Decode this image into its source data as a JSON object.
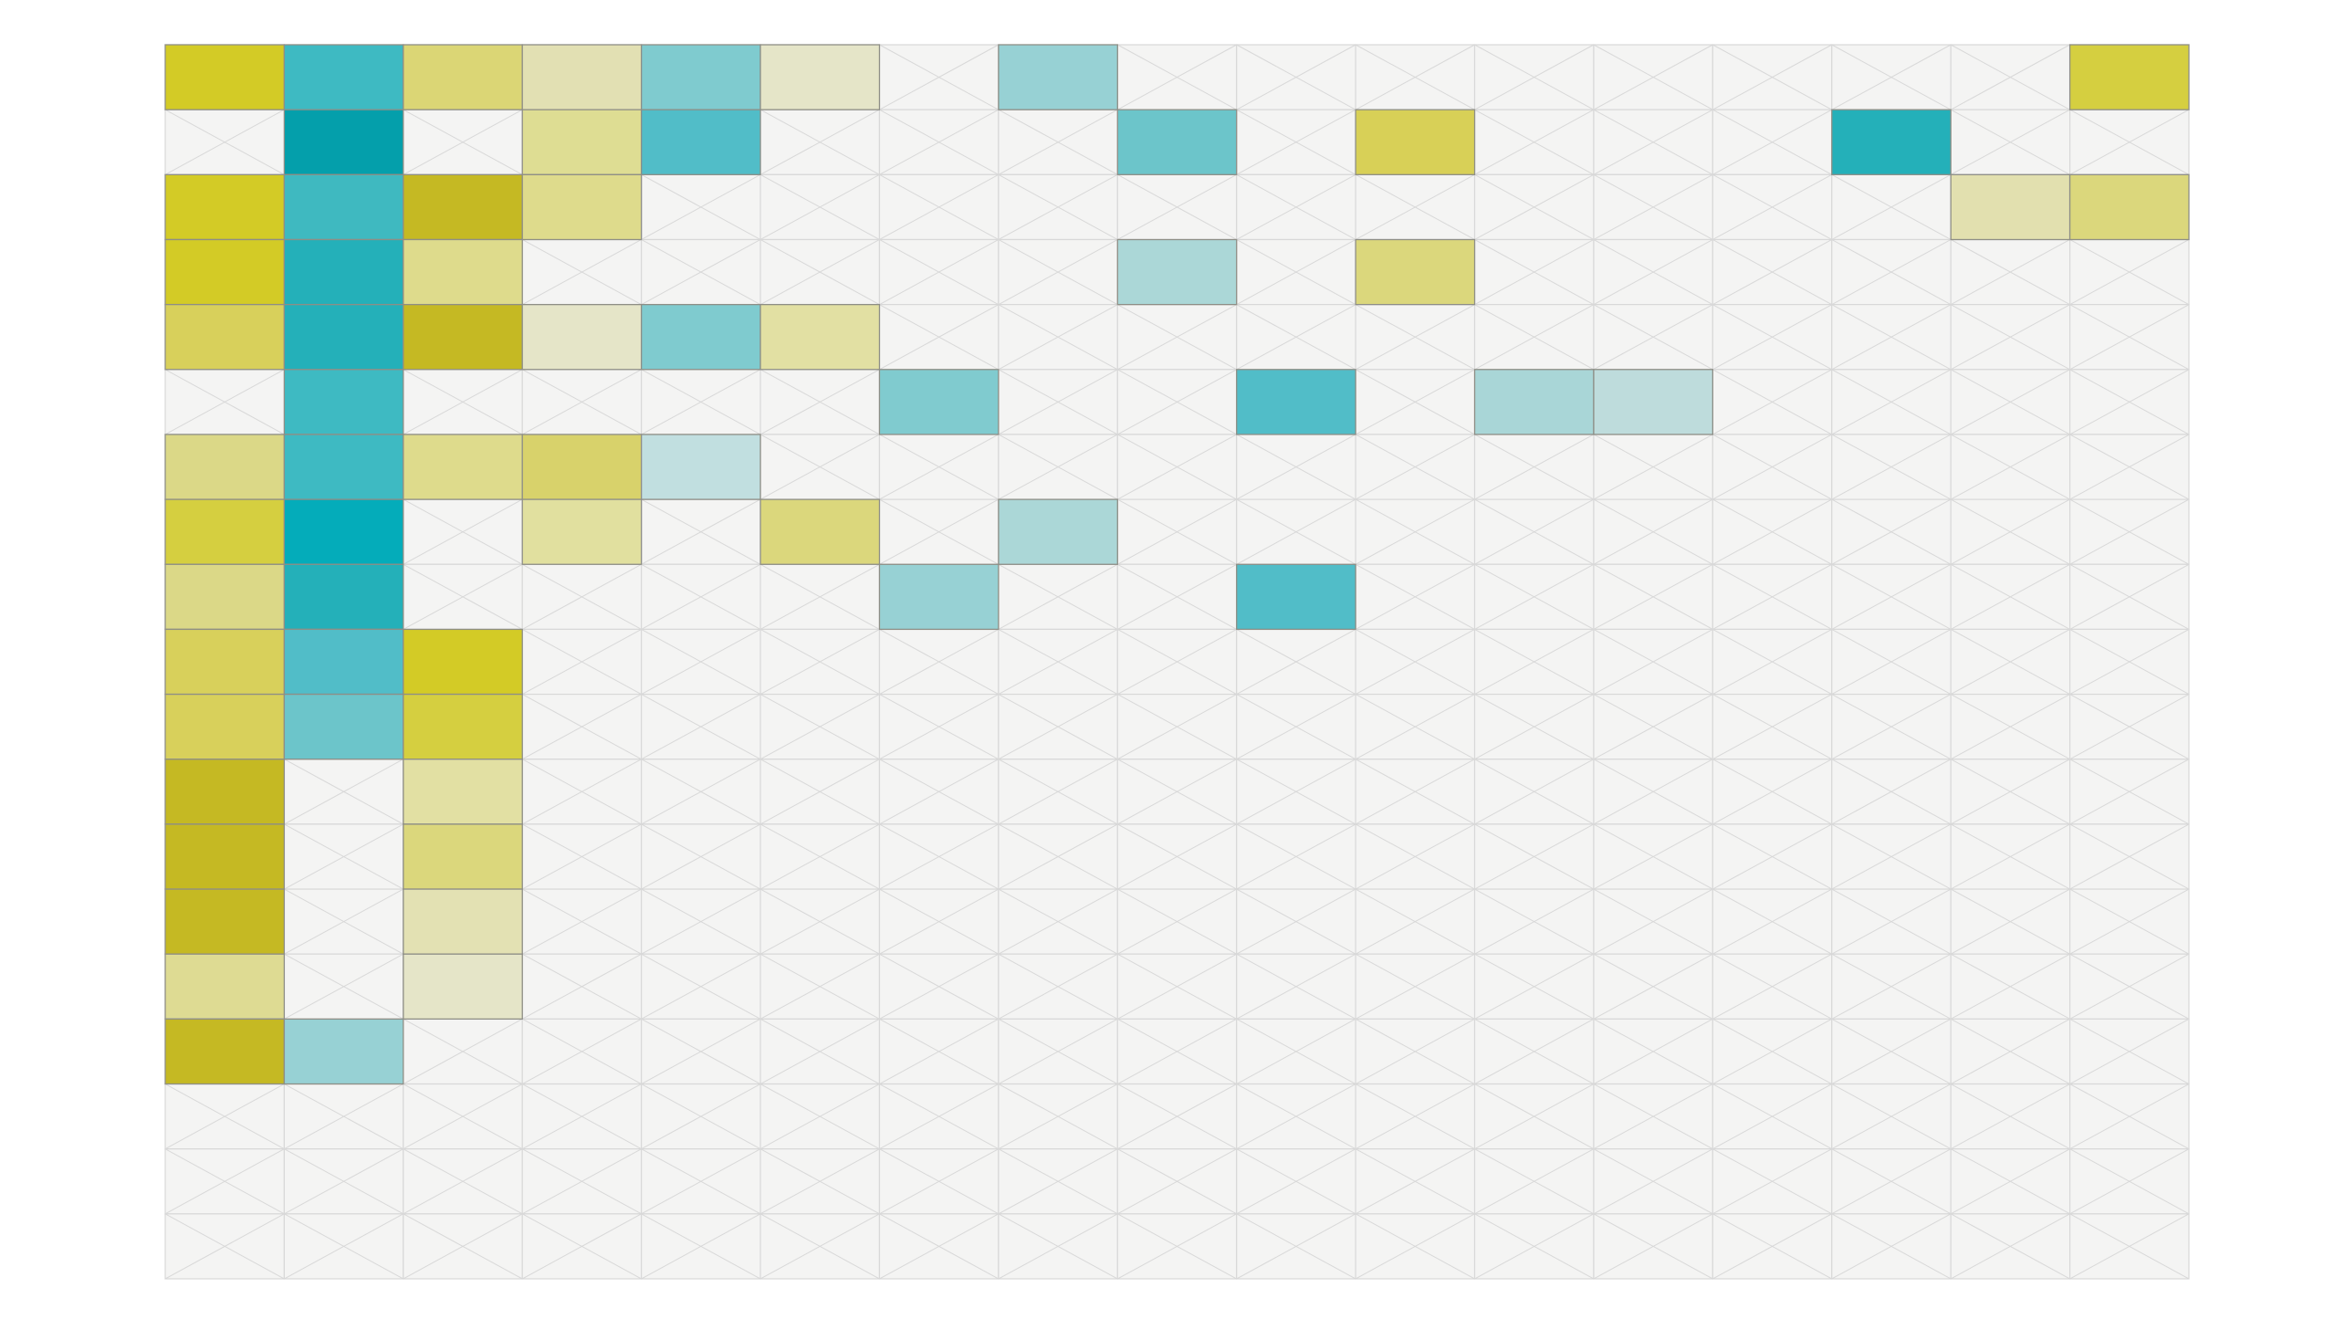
{
  "chart_data": {
    "type": "heatmap",
    "n_cols": 17,
    "n_rows": 19,
    "title": "",
    "xlabel": "",
    "ylabel": "",
    "grid": true,
    "legend": "none",
    "empty_cell_fill": "#f4f4f3",
    "empty_cell_line": "#d8d8d8",
    "cells": [
      {
        "row": 0,
        "col": 0,
        "color": "#d3cb26"
      },
      {
        "row": 0,
        "col": 1,
        "color": "#3ebac2"
      },
      {
        "row": 0,
        "col": 2,
        "color": "#dbd675"
      },
      {
        "row": 0,
        "col": 3,
        "color": "#e2e0b3"
      },
      {
        "row": 0,
        "col": 4,
        "color": "#7fcbcf"
      },
      {
        "row": 0,
        "col": 5,
        "color": "#e5e5c8"
      },
      {
        "row": 0,
        "col": 7,
        "color": "#97d1d4"
      },
      {
        "row": 0,
        "col": 16,
        "color": "#d5cf40"
      },
      {
        "row": 1,
        "col": 1,
        "color": "#049fab"
      },
      {
        "row": 1,
        "col": 3,
        "color": "#dedd93"
      },
      {
        "row": 1,
        "col": 4,
        "color": "#51bdc8"
      },
      {
        "row": 1,
        "col": 8,
        "color": "#6cc5ca"
      },
      {
        "row": 1,
        "col": 10,
        "color": "#d8d057"
      },
      {
        "row": 1,
        "col": 14,
        "color": "#24b0b9"
      },
      {
        "row": 2,
        "col": 0,
        "color": "#d3cb26"
      },
      {
        "row": 2,
        "col": 1,
        "color": "#3fb9c0"
      },
      {
        "row": 2,
        "col": 2,
        "color": "#c5b923"
      },
      {
        "row": 2,
        "col": 3,
        "color": "#dedb8c"
      },
      {
        "row": 2,
        "col": 15,
        "color": "#e2e0af"
      },
      {
        "row": 2,
        "col": 16,
        "color": "#dbd77c"
      },
      {
        "row": 3,
        "col": 0,
        "color": "#d3cb26"
      },
      {
        "row": 3,
        "col": 1,
        "color": "#24b0b9"
      },
      {
        "row": 3,
        "col": 2,
        "color": "#dedb8c"
      },
      {
        "row": 3,
        "col": 8,
        "color": "#abd7d7"
      },
      {
        "row": 3,
        "col": 10,
        "color": "#dbd77c"
      },
      {
        "row": 4,
        "col": 0,
        "color": "#d8d05b"
      },
      {
        "row": 4,
        "col": 1,
        "color": "#24b0b9"
      },
      {
        "row": 4,
        "col": 2,
        "color": "#c5b923"
      },
      {
        "row": 4,
        "col": 3,
        "color": "#e5e5c8"
      },
      {
        "row": 4,
        "col": 4,
        "color": "#7fcbcf"
      },
      {
        "row": 4,
        "col": 5,
        "color": "#e2e0a3"
      },
      {
        "row": 5,
        "col": 1,
        "color": "#3ebac2"
      },
      {
        "row": 5,
        "col": 6,
        "color": "#80cbcf"
      },
      {
        "row": 5,
        "col": 9,
        "color": "#51bdc8"
      },
      {
        "row": 5,
        "col": 11,
        "color": "#a9d6d7"
      },
      {
        "row": 5,
        "col": 12,
        "color": "#bedcdc"
      },
      {
        "row": 6,
        "col": 0,
        "color": "#dbd887"
      },
      {
        "row": 6,
        "col": 1,
        "color": "#3ebac2"
      },
      {
        "row": 6,
        "col": 2,
        "color": "#dedb8c"
      },
      {
        "row": 6,
        "col": 3,
        "color": "#d8d26b"
      },
      {
        "row": 6,
        "col": 4,
        "color": "#c1dfe0"
      },
      {
        "row": 7,
        "col": 0,
        "color": "#d5cf40"
      },
      {
        "row": 7,
        "col": 1,
        "color": "#04acba"
      },
      {
        "row": 7,
        "col": 3,
        "color": "#e1e09f"
      },
      {
        "row": 7,
        "col": 5,
        "color": "#dbd77c"
      },
      {
        "row": 7,
        "col": 7,
        "color": "#abd7d7"
      },
      {
        "row": 8,
        "col": 0,
        "color": "#dbd887"
      },
      {
        "row": 8,
        "col": 1,
        "color": "#24b0b9"
      },
      {
        "row": 8,
        "col": 6,
        "color": "#97d1d4"
      },
      {
        "row": 8,
        "col": 9,
        "color": "#51bdc8"
      },
      {
        "row": 9,
        "col": 0,
        "color": "#d8d05b"
      },
      {
        "row": 9,
        "col": 1,
        "color": "#51bdc8"
      },
      {
        "row": 9,
        "col": 2,
        "color": "#d3cb26"
      },
      {
        "row": 10,
        "col": 0,
        "color": "#d8d05b"
      },
      {
        "row": 10,
        "col": 1,
        "color": "#6cc5ca"
      },
      {
        "row": 10,
        "col": 2,
        "color": "#d5cf40"
      },
      {
        "row": 11,
        "col": 0,
        "color": "#c5b923"
      },
      {
        "row": 11,
        "col": 2,
        "color": "#e2e0a3"
      },
      {
        "row": 12,
        "col": 0,
        "color": "#c5b923"
      },
      {
        "row": 12,
        "col": 2,
        "color": "#dbd77c"
      },
      {
        "row": 13,
        "col": 0,
        "color": "#c5b923"
      },
      {
        "row": 13,
        "col": 2,
        "color": "#e3e1b3"
      },
      {
        "row": 14,
        "col": 0,
        "color": "#dedb93"
      },
      {
        "row": 14,
        "col": 2,
        "color": "#e5e5c8"
      },
      {
        "row": 15,
        "col": 0,
        "color": "#c5b923"
      },
      {
        "row": 15,
        "col": 1,
        "color": "#97d1d4"
      }
    ]
  }
}
